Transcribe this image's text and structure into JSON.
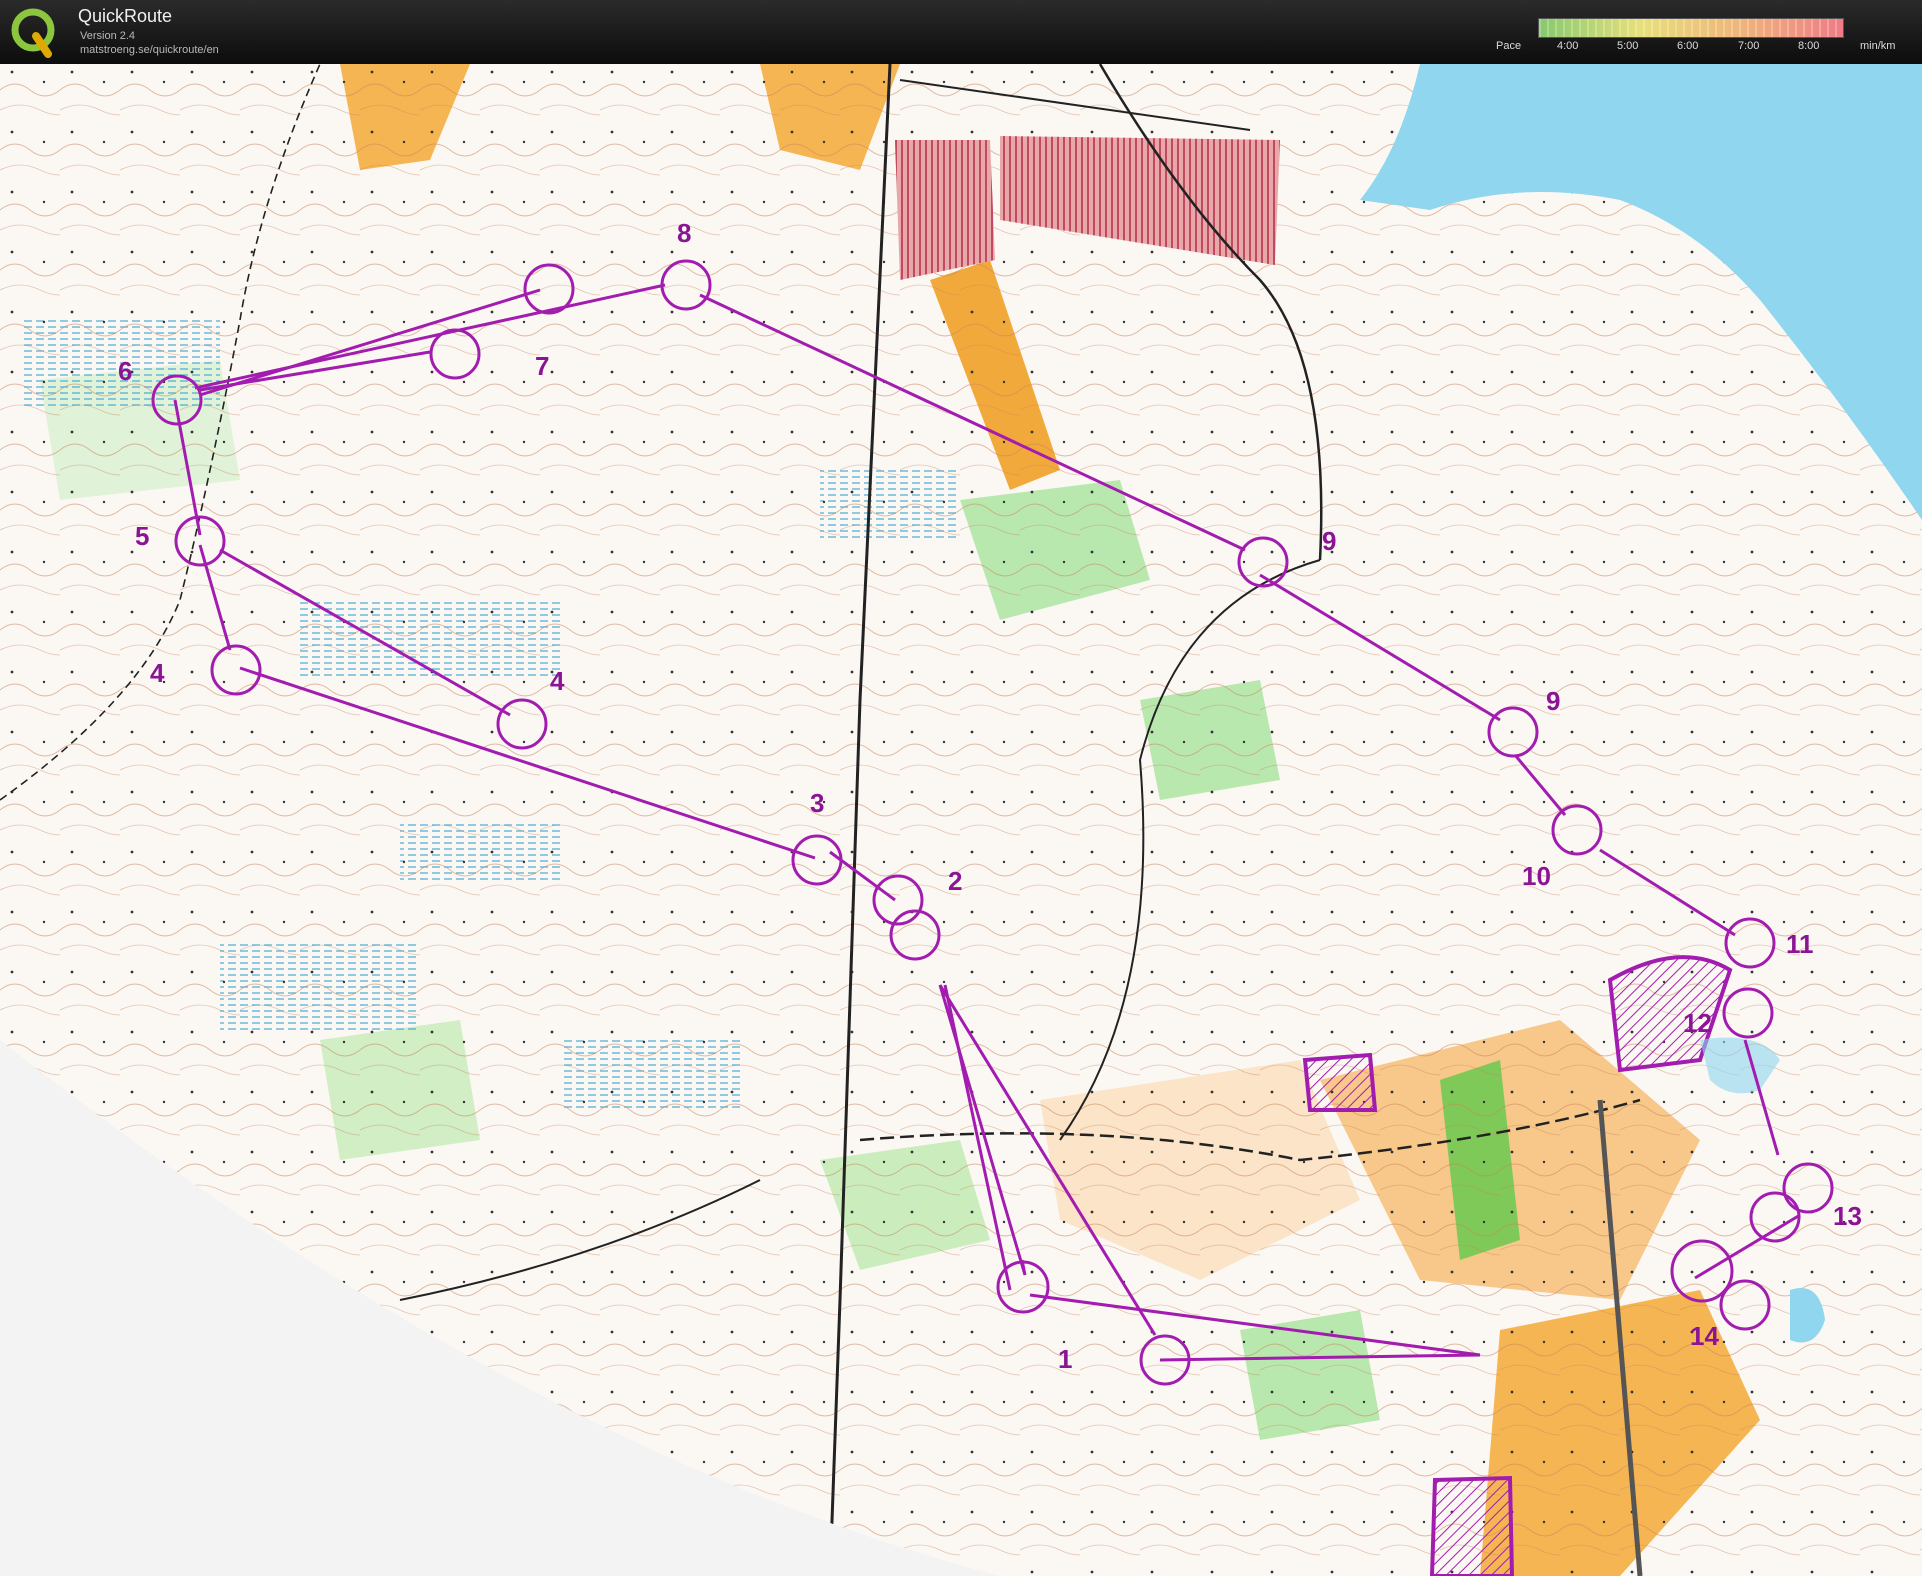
{
  "app": {
    "title": "QuickRoute",
    "version": "Version 2.4",
    "url": "matstroeng.se/quickroute/en"
  },
  "pace_legend": {
    "label": "Pace",
    "ticks": [
      "4:00",
      "5:00",
      "6:00",
      "7:00",
      "8:00"
    ],
    "unit": "min/km",
    "gradient_colors": [
      "#86c96e",
      "#e7e07a",
      "#f0b47a",
      "#ef7b86"
    ]
  },
  "map": {
    "course_color": "#a21caf",
    "water_color": "#8fd6ee",
    "control_labels": [
      {
        "text": "1"
      },
      {
        "text": "2"
      },
      {
        "text": "3"
      },
      {
        "text": "4"
      },
      {
        "text": "4"
      },
      {
        "text": "5"
      },
      {
        "text": "6"
      },
      {
        "text": "7"
      },
      {
        "text": "8"
      },
      {
        "text": "9"
      },
      {
        "text": "9"
      },
      {
        "text": "10"
      },
      {
        "text": "11"
      },
      {
        "text": "12"
      },
      {
        "text": "13"
      },
      {
        "text": "14"
      }
    ]
  }
}
